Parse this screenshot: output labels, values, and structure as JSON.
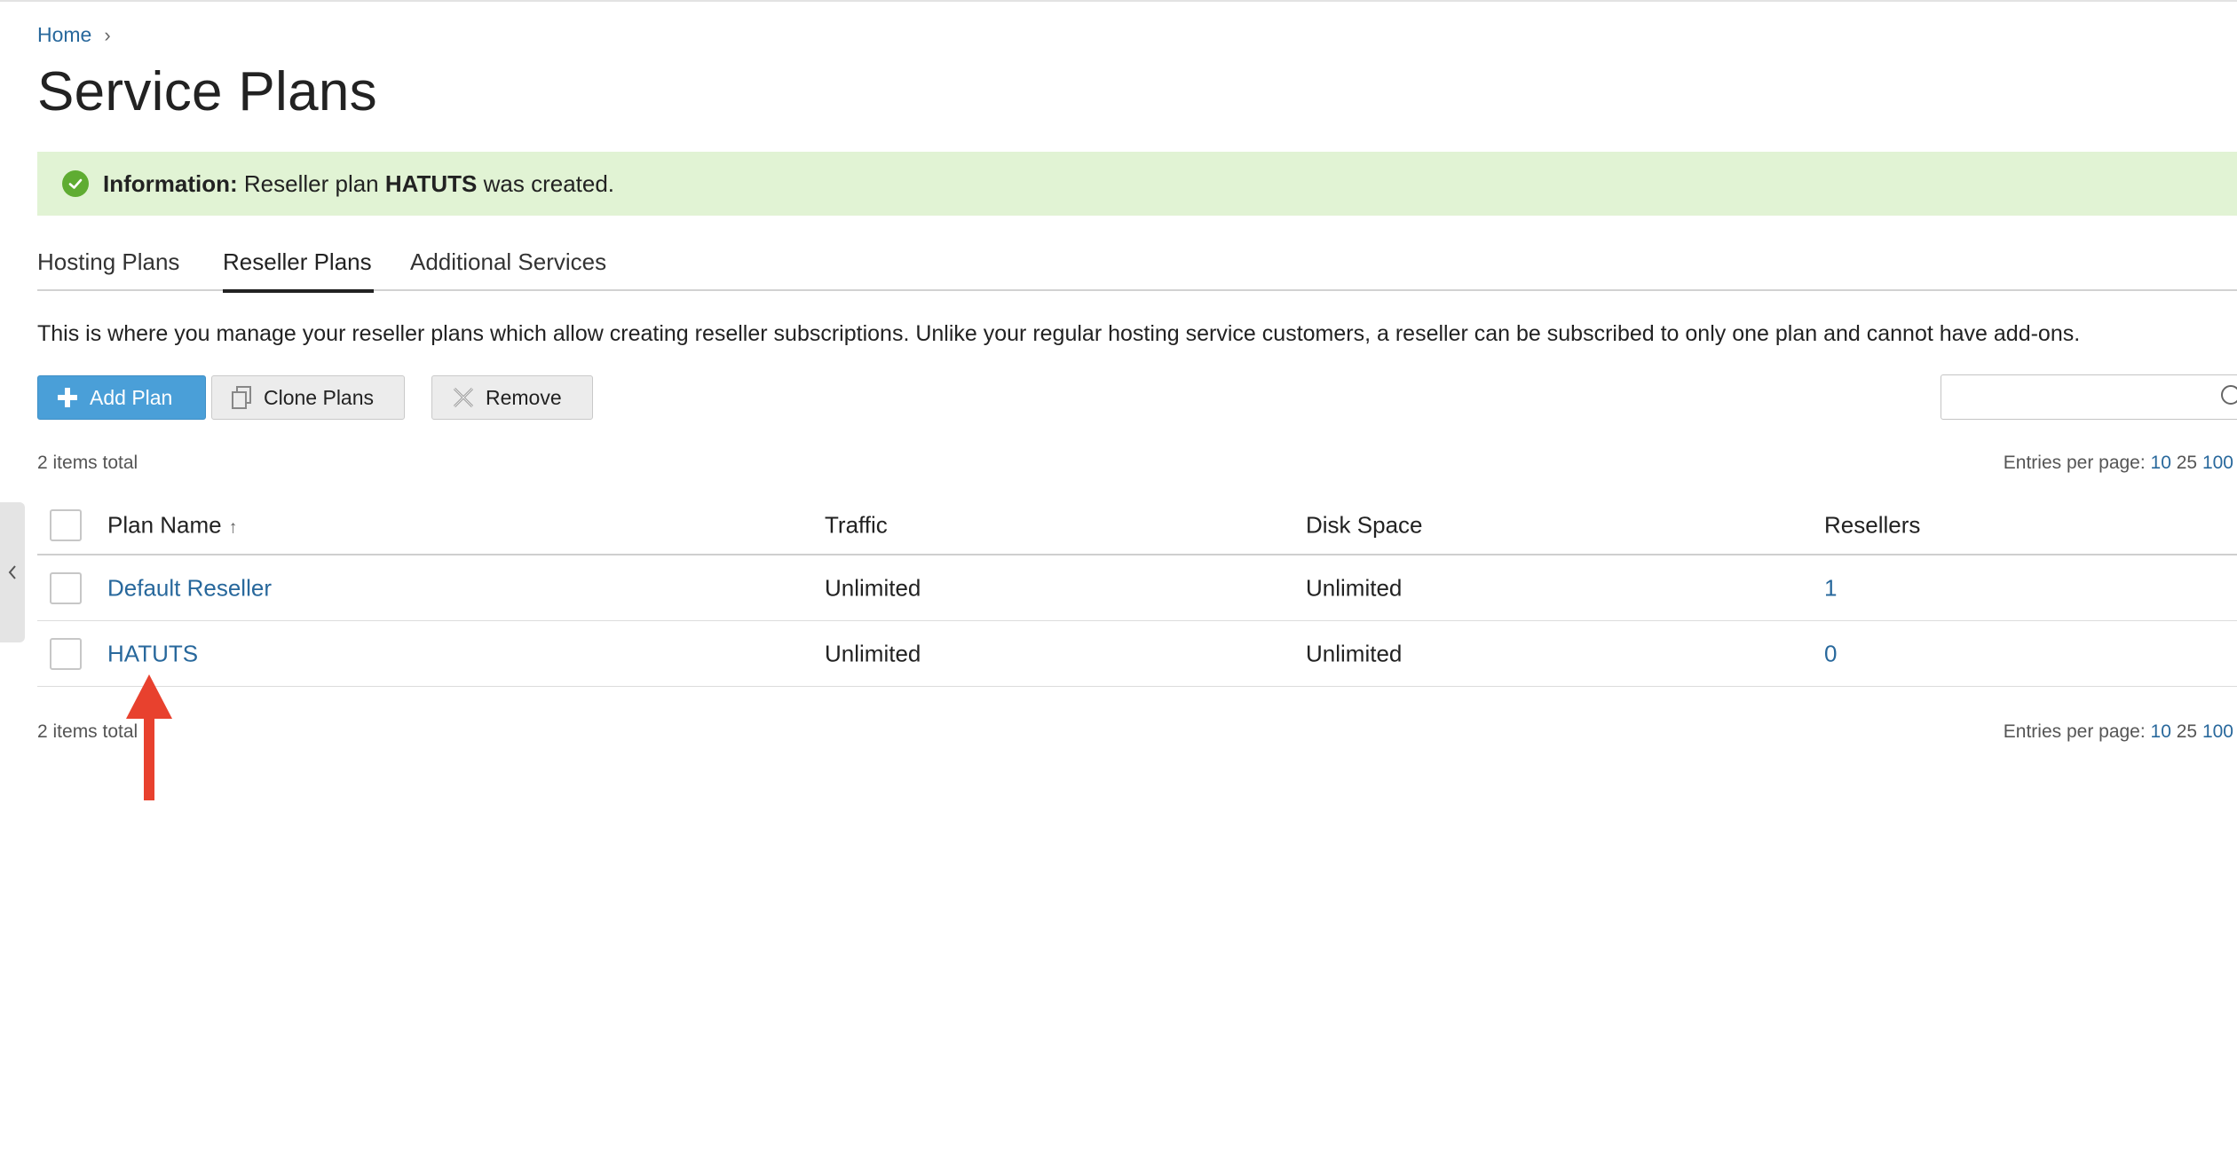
{
  "breadcrumb": {
    "home": "Home"
  },
  "page_title": "Service Plans",
  "message": {
    "label": "Information:",
    "pre": "Reseller plan",
    "plan": "HATUTS",
    "post": "was created."
  },
  "tabs": [
    {
      "label": "Hosting Plans",
      "active": false
    },
    {
      "label": "Reseller Plans",
      "active": true
    },
    {
      "label": "Additional Services",
      "active": false
    }
  ],
  "description": "This is where you manage your reseller plans which allow creating reseller subscriptions. Unlike your regular hosting service customers, a reseller can be subscribed to only one plan and cannot have add-ons.",
  "toolbar": {
    "add_label": "Add Plan",
    "clone_label": "Clone Plans",
    "remove_label": "Remove"
  },
  "search": {
    "placeholder": ""
  },
  "pagination": {
    "items_total": "2 items total",
    "entries_label": "Entries per page:",
    "sizes": [
      "10",
      "25",
      "100"
    ]
  },
  "table": {
    "headers": {
      "plan_name": "Plan Name",
      "sort_glyph": "↑",
      "traffic": "Traffic",
      "disk_space": "Disk Space",
      "resellers": "Resellers"
    },
    "rows": [
      {
        "plan_name": "Default Reseller",
        "traffic": "Unlimited",
        "disk_space": "Unlimited",
        "resellers": "1"
      },
      {
        "plan_name": "HATUTS",
        "traffic": "Unlimited",
        "disk_space": "Unlimited",
        "resellers": "0"
      }
    ]
  },
  "colors": {
    "link": "#28689c",
    "primary_button": "#4a9fd8",
    "success_bg": "#e1f3d4",
    "success_icon": "#5fac32",
    "annotation_arrow": "#e8412e"
  }
}
